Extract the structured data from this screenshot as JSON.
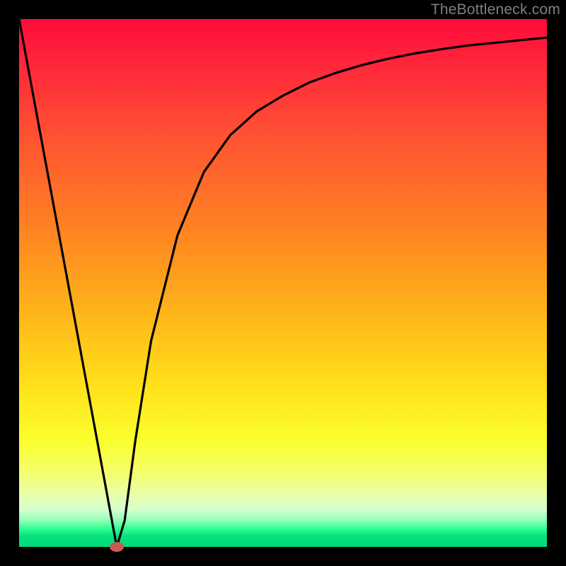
{
  "watermark": "TheBottleneck.com",
  "chart_data": {
    "type": "line",
    "title": "",
    "xlabel": "",
    "ylabel": "",
    "xlim": [
      0,
      100
    ],
    "ylim": [
      0,
      100
    ],
    "grid": false,
    "legend": false,
    "series": [
      {
        "name": "bottleneck-curve",
        "x": [
          0,
          5,
          10,
          15,
          18.5,
          20,
          22,
          25,
          30,
          35,
          40,
          45,
          50,
          55,
          60,
          65,
          70,
          75,
          80,
          85,
          90,
          95,
          100
        ],
        "y": [
          100,
          73,
          46,
          19,
          0,
          5,
          20,
          39,
          59,
          71,
          78,
          82.5,
          85.5,
          88,
          89.8,
          91.3,
          92.5,
          93.5,
          94.3,
          95,
          95.5,
          96,
          96.5
        ]
      }
    ],
    "marker": {
      "x": 18.5,
      "y": 0,
      "color": "#c85a54"
    },
    "background_gradient": {
      "stops": [
        {
          "pos": 0.0,
          "color": "#ff0b3a"
        },
        {
          "pos": 0.4,
          "color": "#ff8322"
        },
        {
          "pos": 0.7,
          "color": "#ffe21a"
        },
        {
          "pos": 0.9,
          "color": "#e9ffa8"
        },
        {
          "pos": 0.97,
          "color": "#32ff94"
        },
        {
          "pos": 1.0,
          "color": "#04db7c"
        }
      ]
    }
  }
}
